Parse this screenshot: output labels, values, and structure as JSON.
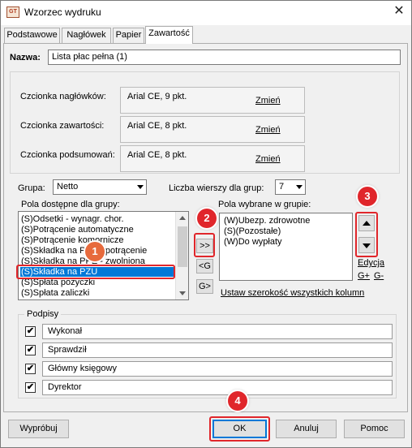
{
  "window": {
    "title": "Wzorzec wydruku",
    "app_icon_text": "GT",
    "close_glyph": "✕"
  },
  "tabs": [
    {
      "label": "Podstawowe",
      "active": false
    },
    {
      "label": "Nagłówek",
      "active": false
    },
    {
      "label": "Papier",
      "active": false
    },
    {
      "label": "Zawartość",
      "active": true
    }
  ],
  "name": {
    "label": "Nazwa:",
    "value": "Lista płac pełna (1)"
  },
  "fonts": [
    {
      "label": "Czcionka nagłówków:",
      "value": "Arial CE, 9 pkt.",
      "action": "Zmień"
    },
    {
      "label": "Czcionka zawartości:",
      "value": "Arial CE, 8 pkt.",
      "action": "Zmień"
    },
    {
      "label": "Czcionka podsumowań:",
      "value": "Arial CE, 8 pkt.",
      "action": "Zmień"
    }
  ],
  "group": {
    "label": "Grupa:",
    "value": "Netto",
    "rows_label": "Liczba wierszy dla grup:",
    "rows_value": "7"
  },
  "available": {
    "label": "Pola dostępne dla grupy:",
    "items": [
      "(S)Odsetki - wynagr. chor.",
      "(S)Potrącenie automatyczne",
      "(S)Potrącenie komornicze",
      "(S)Składka na PPE - potrącenie",
      "(S)Składka na PPE - zwolniona",
      "(S)Składka na PZU",
      "(S)Spłata pożyczki",
      "(S)Spłata zaliczki"
    ],
    "selected_index": 5
  },
  "transfer": {
    "add_all": ">>",
    "remove": "<G",
    "add": "G>"
  },
  "selected": {
    "label": "Pola wybrane w grupie:",
    "items": [
      "(W)Ubezp. zdrowotne",
      "(S)(Pozostałe)",
      "(W)Do wypłaty"
    ]
  },
  "side_links": {
    "edit": "Edycja",
    "g_plus": "G+",
    "g_minus": "G-"
  },
  "width_link": "Ustaw szerokość wszystkich kolumn",
  "signatures": {
    "legend": "Podpisy",
    "items": [
      {
        "checked": true,
        "value": "Wykonał"
      },
      {
        "checked": true,
        "value": "Sprawdził"
      },
      {
        "checked": true,
        "value": "Główny księgowy"
      },
      {
        "checked": true,
        "value": "Dyrektor"
      }
    ],
    "check_glyph": "✔"
  },
  "buttons": {
    "try": "Wypróbuj",
    "ok": "OK",
    "cancel": "Anuluj",
    "help": "Pomoc"
  },
  "annotations": [
    "1",
    "2",
    "3",
    "4"
  ],
  "colors": {
    "selection": "#0078d7",
    "annotation": "#e0262b"
  }
}
